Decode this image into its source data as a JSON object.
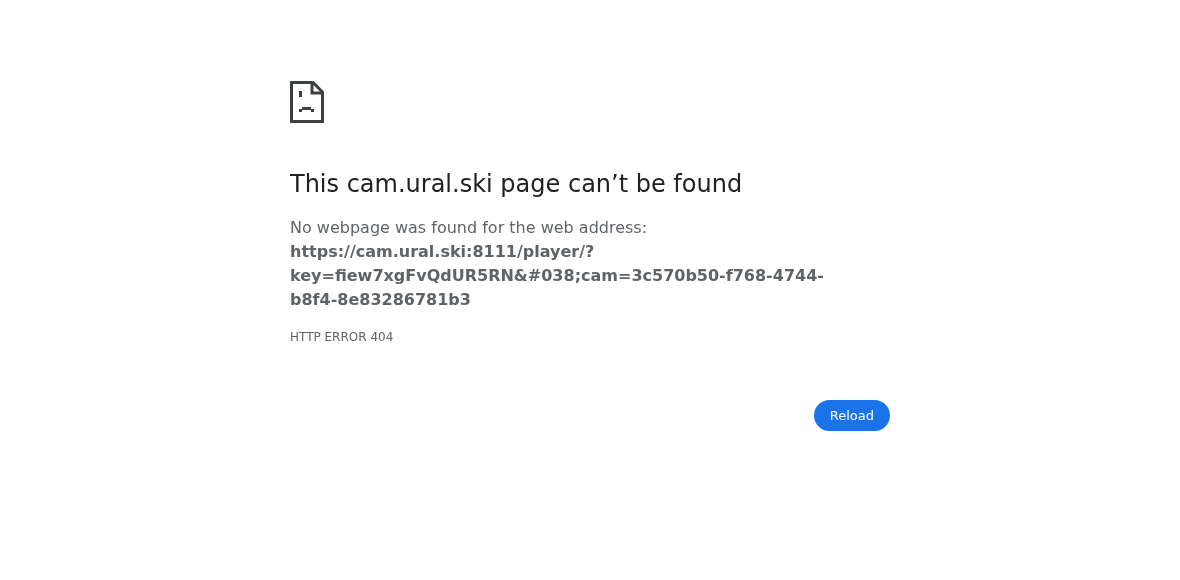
{
  "title": "This cam.ural.ski page can’t be found",
  "description": "No webpage was found for the web address:",
  "url": "https://cam.ural.ski:8111/player/?key=fiew7xgFvQdUR5RN&#038;cam=3c570b50-f768-4744-b8f4-8e83286781b3",
  "error_code": "HTTP ERROR 404",
  "buttons": [
    {
      "label": "Reload"
    }
  ]
}
